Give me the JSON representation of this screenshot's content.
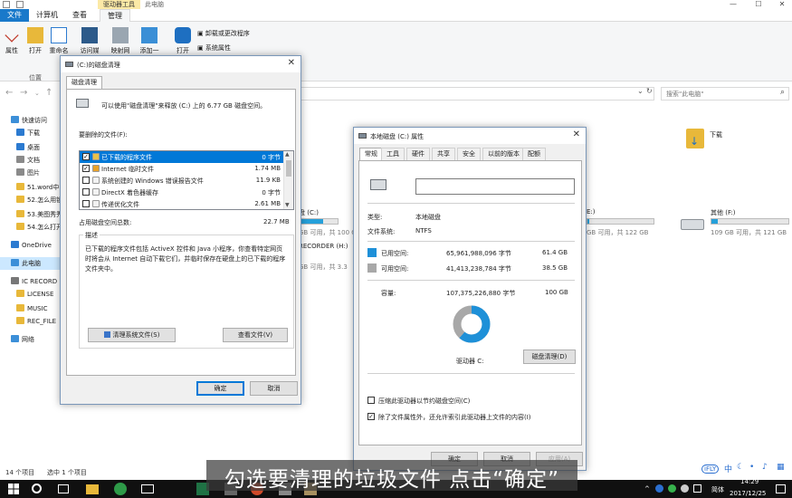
{
  "explorer": {
    "title_bar": {
      "ctx_tab": "驱动器工具",
      "title": "此电脑",
      "minimize": "—",
      "maximize": "☐",
      "close": "✕"
    },
    "ribbon_tabs": {
      "file": "文件",
      "computer": "计算机",
      "view": "查看",
      "manage": "管理"
    },
    "ribbon": {
      "properties": "属性",
      "open": "打开",
      "rename": "重命名",
      "access_media": "访问媒体",
      "map_drive": "映射网络",
      "add_location": "添加一个",
      "open_settings": "打开",
      "uninstall": "卸载或更改程序",
      "system_props": "系统属性",
      "location_group": "位置"
    },
    "search_placeholder": "搜索\"此电脑\"",
    "nav": [
      {
        "label": "快速访问",
        "color": "#3c8fd8"
      },
      {
        "label": "下载",
        "color": "#2b7ad0"
      },
      {
        "label": "桌面",
        "color": "#2b7ad0"
      },
      {
        "label": "文档",
        "color": "#8a8a8a"
      },
      {
        "label": "图片",
        "color": "#8a8a8a"
      },
      {
        "label": "51.word中",
        "color": "#e8b83a"
      },
      {
        "label": "52.怎么用锁",
        "color": "#e8b83a"
      },
      {
        "label": "53.美图秀秀",
        "color": "#e8b83a"
      },
      {
        "label": "54.怎么打开",
        "color": "#e8b83a"
      },
      {
        "label": "OneDrive",
        "color": "#2b7ad0"
      },
      {
        "label": "此电脑",
        "color": "#3c8fd8"
      },
      {
        "label": "IC RECORD",
        "color": "#777777"
      },
      {
        "label": "LICENSE",
        "color": "#e8b83a"
      },
      {
        "label": "MUSIC",
        "color": "#e8b83a"
      },
      {
        "label": "REC_FILE",
        "color": "#e8b83a"
      },
      {
        "label": "网络",
        "color": "#3c8fd8"
      }
    ],
    "content": {
      "downloads": "下载",
      "drive_c_label": "盘 (C:)",
      "drive_c_free": "GB 可用，共 100 GB",
      "drive_e_label": "E:)",
      "drive_e_free": "GB 可用，共 122 GB",
      "drive_f_label": "其他 (F:)",
      "drive_f_free": "109 GB 可用，共 121 GB",
      "drive_c_used_fraction": 0.61,
      "drive_e_used_fraction": 0.03,
      "drive_f_used_fraction": 0.08,
      "ic_recorder": "RECORDER (H:)",
      "ic_recorder_free": "GB 可用，共 3.3"
    },
    "status": {
      "count": "14 个项目",
      "selected": "选中 1 个项目"
    }
  },
  "cleanup": {
    "title": "(C:)的磁盘清理",
    "tab": "磁盘清理",
    "intro": "可以使用\"磁盘清理\"来释放 (C:) 上的 6.77 GB 磁盘空间。",
    "files_label": "要删除的文件(F):",
    "files": [
      {
        "checked": true,
        "name": "已下载的程序文件",
        "size": "0 字节",
        "color": "#e9c24a"
      },
      {
        "checked": true,
        "name": "Internet 临时文件",
        "size": "1.74 MB",
        "color": "#e8a22a"
      },
      {
        "checked": false,
        "name": "系统创建的 Windows 错误报告文件",
        "size": "11.9 KB",
        "color": "#f2f2f2"
      },
      {
        "checked": false,
        "name": "DirectX 着色器缓存",
        "size": "0 字节",
        "color": "#f2f2f2"
      },
      {
        "checked": false,
        "name": "传递优化文件",
        "size": "2.61 MB",
        "color": "#f2f2f2"
      }
    ],
    "total_label": "占用磁盘空间总数:",
    "total_value": "22.7 MB",
    "desc_legend": "描述",
    "desc_text": "已下载的程序文件包括 ActiveX 控件和 Java 小程序，你查看特定网页时将会从 Internet 自动下载它们，并临时保存在硬盘上的已下载的程序文件夹中。",
    "clean_system_btn": "清理系统文件(S)",
    "view_files_btn": "查看文件(V)",
    "ok": "确定",
    "cancel": "取消"
  },
  "props": {
    "title": "本地磁盘 (C:) 属性",
    "tabs": [
      "常规",
      "工具",
      "硬件",
      "共享",
      "安全",
      "以前的版本",
      "配额"
    ],
    "type_label": "类型:",
    "type_value": "本地磁盘",
    "fs_label": "文件系统:",
    "fs_value": "NTFS",
    "used_label": "已用空间:",
    "used_bytes": "65,961,988,096 字节",
    "used_gb": "61.4 GB",
    "free_label": "可用空间:",
    "free_bytes": "41,413,238,784 字节",
    "free_gb": "38.5 GB",
    "capacity_label": "容量:",
    "capacity_bytes": "107,375,226,880 字节",
    "capacity_gb": "100 GB",
    "drive_label": "驱动器 C:",
    "cleanup_btn": "磁盘清理(D)",
    "compress_label": "压缩此驱动器以节约磁盘空间(C)",
    "index_label": "除了文件属性外，还允许索引此驱动器上文件的内容(I)",
    "ok": "确定",
    "cancel": "取消",
    "apply": "应用(A)",
    "used_color": "#1e90d8",
    "free_color": "#a8a8a8",
    "used_fraction": 0.614
  },
  "taskbar": {
    "time": "14:29",
    "date": "2017/12/25",
    "lang": "简体"
  },
  "subtitle": "勾选要清理的垃圾文件 点击“确定”",
  "badge": {
    "brand": "iFLY",
    "ime": "中"
  }
}
